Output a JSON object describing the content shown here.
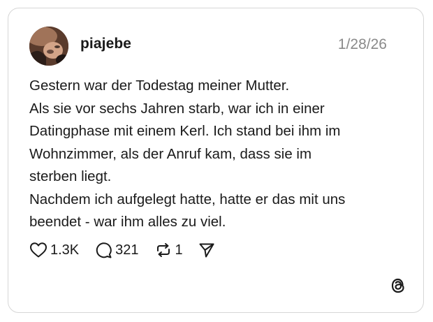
{
  "post": {
    "username": "piajebe",
    "date": "1/28/26",
    "lines": [
      "Gestern war der Todestag meiner Mutter.",
      "Als sie vor sechs Jahren starb, war ich in einer",
      "Datingphase mit einem Kerl. Ich stand bei ihm im",
      "Wohnzimmer, als der Anruf kam, dass sie im",
      "sterben liegt.",
      "Nachdem ich aufgelegt hatte, hatte er das mit uns",
      "beendet - war ihm alles zu viel."
    ]
  },
  "actions": {
    "likes": "1.3K",
    "replies": "321",
    "reposts": "1"
  },
  "icons": {
    "like": "heart-icon",
    "reply": "comment-bubble-icon",
    "repost": "repost-icon",
    "share": "send-icon",
    "brand": "threads-logo-icon"
  }
}
